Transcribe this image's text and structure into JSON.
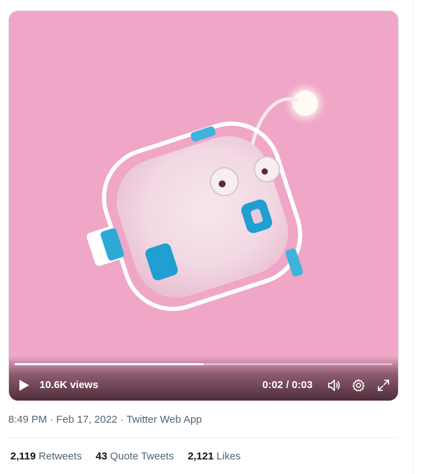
{
  "video": {
    "views": "10.6K views",
    "time": "0:02 / 0:03",
    "progress": 0.5,
    "icons": [
      "play-icon",
      "volume-icon",
      "settings-icon",
      "fullscreen-icon"
    ]
  },
  "meta": {
    "time": "8:49 PM",
    "date": "Feb 17, 2022",
    "source": "Twitter Web App"
  },
  "stats": [
    {
      "value": "2,119",
      "label": "Retweets"
    },
    {
      "value": "43",
      "label": "Quote Tweets"
    },
    {
      "value": "2,121",
      "label": "Likes"
    }
  ],
  "colors": {
    "video_background": "#efa6c7",
    "muted_text": "#536471",
    "primary_text": "#0f1419"
  }
}
